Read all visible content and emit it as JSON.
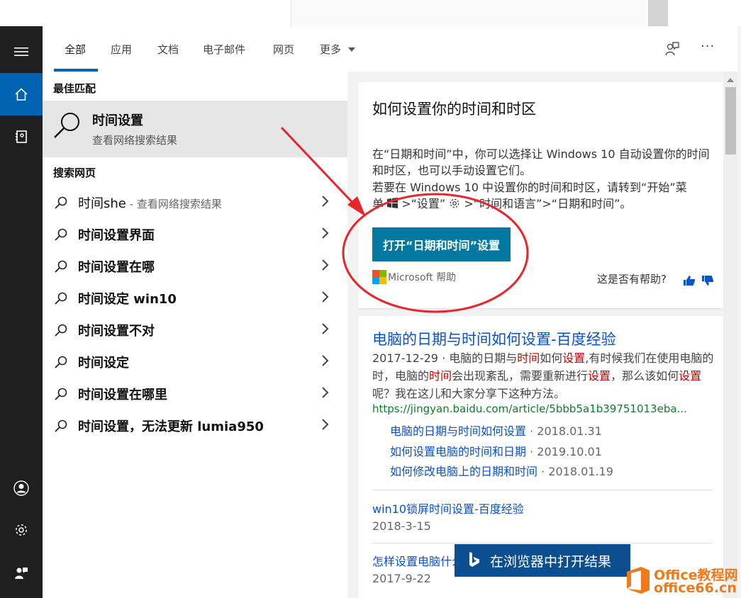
{
  "tabs": {
    "all": "全部",
    "apps": "应用",
    "docs": "文档",
    "email": "电子邮件",
    "web": "网页",
    "more": "更多",
    "more_dots": "···"
  },
  "left": {
    "best_match_header": "最佳匹配",
    "best_match": {
      "title": "时间设置",
      "subtitle": "查看网络搜索结果"
    },
    "search_web_header": "搜索网页",
    "suggestions": [
      {
        "text": "时间she",
        "hint": " - 查看网络搜索结果"
      },
      {
        "text": "时间设置界面"
      },
      {
        "text": "时间设置在哪"
      },
      {
        "text": "时间设定 win10"
      },
      {
        "text": "时间设置不对"
      },
      {
        "text": "时间设定"
      },
      {
        "text": "时间设置在哪里"
      },
      {
        "text": "时间设置，无法更新 lumia950"
      }
    ]
  },
  "answer_card": {
    "title": "如何设置你的时间和时区",
    "para1": "在“日期和时间”中，你可以选择让 Windows 10 自动设置你的时间和时区，也可以手动设置它们。",
    "para2_line1": "若要在 Windows 10 中设置你的时间和时区，请转到“开始”菜",
    "para2_a": "单",
    "para2_b": ">“设置”",
    "para2_c": ">“时间和语言”>“日期和时间”。",
    "button": "打开“日期和时间”设置",
    "source": "Microsoft 帮助",
    "helpful": "这是否有帮助?"
  },
  "result1": {
    "title": "电脑的日期与时间如何设置-百度经验",
    "date": "2017-12-29",
    "snippet_parts": [
      " · 电脑的日期与",
      "时间",
      "如何",
      "设置",
      ",有时候我们在使用电脑的时，电脑的",
      "时间",
      "会出现紊乱，需要重新进行",
      "设置",
      "，那么该如何",
      "设置",
      "呢？我在这儿和大家分享下这种方法。"
    ],
    "url": "https://jingyan.baidu.com/article/5bbb5a1b39751013eba...",
    "sublinks": [
      {
        "title": "电脑的日期与时间如何设置",
        "date": " · 2018.01.31"
      },
      {
        "title": "如何设置电脑的时间和日期",
        "date": " · 2019.10.01"
      },
      {
        "title": "如何修改电脑上的日期和时间",
        "date": " · 2018.01.19"
      }
    ]
  },
  "result2": {
    "title": "win10锁屏时间设置-百度经验",
    "date": "2018-3-15"
  },
  "result3": {
    "title": "怎样设置电脑什么时间关机-百度经验",
    "date": "2017-9-22"
  },
  "bing_button": "在浏览器中打开结果",
  "watermark": {
    "line1": "Office教程网",
    "line2": "office66.cn"
  },
  "colors": {
    "accent": "#0063b1",
    "button": "#0078a0",
    "link": "#0a52c7",
    "url": "#0b7e2b",
    "highlight": "#c00000",
    "annotation": "#e8252a"
  }
}
